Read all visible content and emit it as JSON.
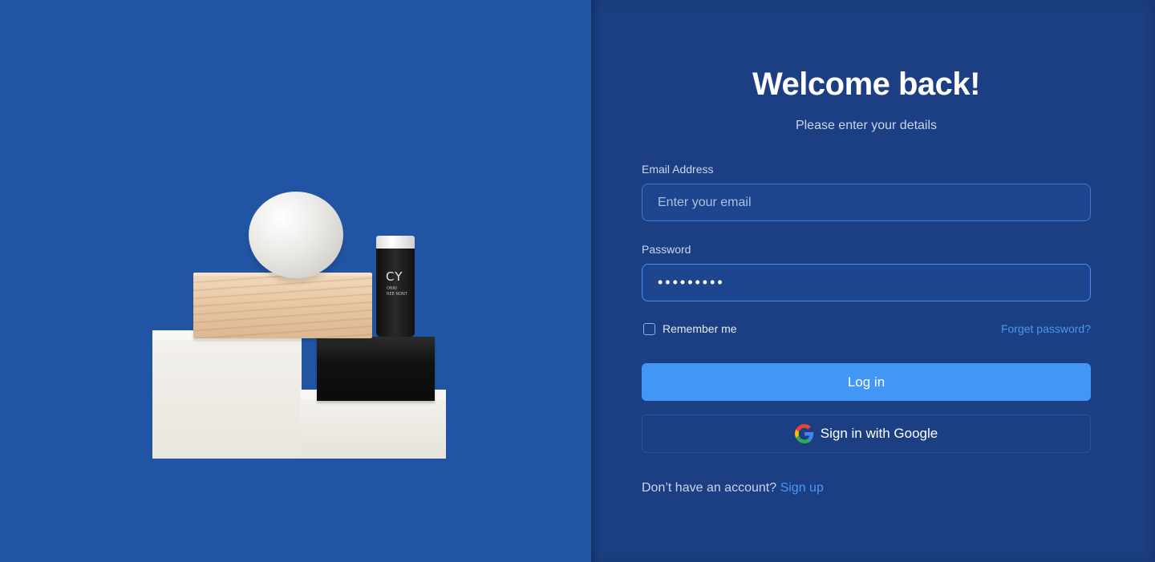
{
  "illustration": {
    "bottle_mark": "CY",
    "bottle_sub_line1": "ONNI",
    "bottle_sub_line2": "REE NONT"
  },
  "login": {
    "title": "Welcome back!",
    "subtitle": "Please enter your details",
    "email": {
      "label": "Email Address",
      "placeholder": "Enter your email",
      "value": ""
    },
    "password": {
      "label": "Password",
      "value": "•••••••••"
    },
    "remember_label": "Remember me",
    "remember_checked": false,
    "forgot_label": "Forget password?",
    "login_button": "Log in",
    "google_button": "Sign in with Google",
    "no_account_text": "Don’t have an account?",
    "signup_link": "Sign up"
  },
  "colors": {
    "left_bg": "#2254a4",
    "right_bg": "#1b3f82",
    "primary_button": "#4196f6",
    "link": "#4a97f5"
  }
}
